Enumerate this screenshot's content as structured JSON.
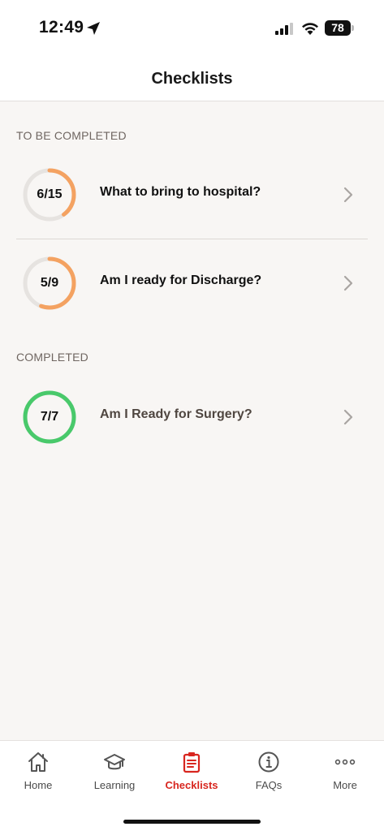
{
  "status_bar": {
    "time": "12:49",
    "battery": "78"
  },
  "header": {
    "title": "Checklists"
  },
  "sections": [
    {
      "label": "TO BE COMPLETED"
    },
    {
      "label": "COMPLETED"
    }
  ],
  "checklists": [
    {
      "title": "What to bring to hospital?",
      "progress_text": "6/15",
      "done": 6,
      "total": 15,
      "color": "#f4a261"
    },
    {
      "title": "Am I ready for Discharge?",
      "progress_text": "5/9",
      "done": 5,
      "total": 9,
      "color": "#f4a261"
    },
    {
      "title": "Am I Ready for Surgery?",
      "progress_text": "7/7",
      "done": 7,
      "total": 7,
      "color": "#49c96b"
    }
  ],
  "tabs": [
    {
      "label": "Home",
      "icon": "home-icon"
    },
    {
      "label": "Learning",
      "icon": "graduation-cap-icon"
    },
    {
      "label": "Checklists",
      "icon": "clipboard-icon",
      "active": true
    },
    {
      "label": "FAQs",
      "icon": "info-icon"
    },
    {
      "label": "More",
      "icon": "more-dots-icon"
    }
  ],
  "colors": {
    "accent": "#d8261f",
    "in_progress": "#f4a261",
    "complete": "#49c96b",
    "ring_track": "#e6e3e0"
  }
}
